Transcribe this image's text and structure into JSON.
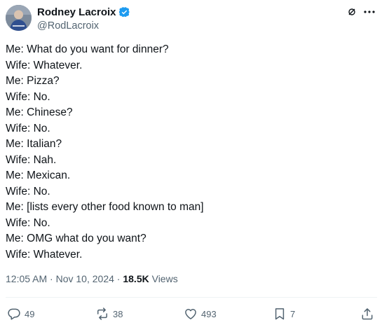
{
  "author": {
    "display_name": "Rodney Lacroix",
    "handle": "@RodLacroix",
    "verified": true,
    "verified_color": "#1d9bf0"
  },
  "tweet": {
    "lines": [
      "Me: What do you want for dinner?",
      "Wife: Whatever.",
      "Me: Pizza?",
      "Wife: No.",
      "Me: Chinese?",
      "Wife: No.",
      "Me: Italian?",
      "Wife: Nah.",
      "Me: Mexican.",
      "Wife: No.",
      "Me: [lists every other food known to man]",
      "Wife: No.",
      "Me: OMG what do you want?",
      "Wife: Whatever."
    ]
  },
  "meta": {
    "time": "12:05 AM",
    "separator": "·",
    "date": "Nov 10, 2024",
    "views_count": "18.5K",
    "views_label": "Views"
  },
  "actions": {
    "replies": "49",
    "reposts": "38",
    "likes": "493",
    "bookmarks": "7"
  },
  "icons": {
    "header": [
      "grok-icon",
      "more-icon"
    ],
    "actions": [
      "reply-icon",
      "repost-icon",
      "like-icon",
      "bookmark-icon",
      "share-icon"
    ]
  },
  "colors": {
    "text": "#0f1419",
    "secondary": "#536471",
    "divider": "#eff3f4",
    "accent": "#1d9bf0"
  }
}
